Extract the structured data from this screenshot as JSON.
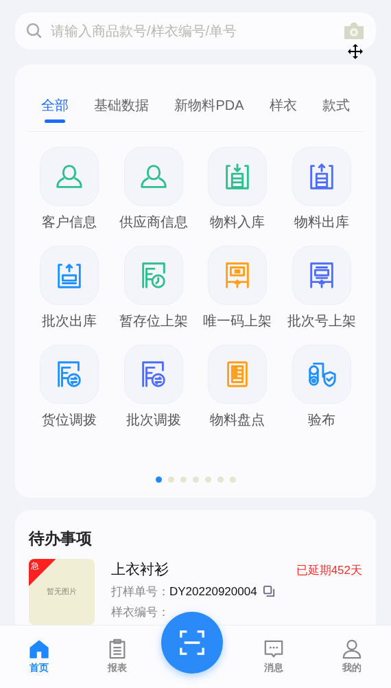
{
  "search": {
    "placeholder": "请输入商品款号/样衣编号/单号"
  },
  "tabs": [
    {
      "label": "全部",
      "selected": true
    },
    {
      "label": "基础数据",
      "selected": false
    },
    {
      "label": "新物料PDA",
      "selected": false
    },
    {
      "label": "样衣",
      "selected": false
    },
    {
      "label": "款式",
      "selected": false
    }
  ],
  "apps": [
    {
      "label": "客户信息",
      "kind": "person",
      "color": "#2fbf8f"
    },
    {
      "label": "供应商信息",
      "kind": "person",
      "color": "#2fbf8f"
    },
    {
      "label": "物料入库",
      "kind": "stock-in",
      "color": "#2fbf8f"
    },
    {
      "label": "物料出库",
      "kind": "stock-out",
      "color": "#4f6ef7"
    },
    {
      "label": "批次出库",
      "kind": "batch-out",
      "color": "#1e90ff"
    },
    {
      "label": "暂存位上架",
      "kind": "clock-shelf",
      "color": "#2fbf8f"
    },
    {
      "label": "唯一码上架",
      "kind": "code-shelf",
      "color": "#ff9f1a"
    },
    {
      "label": "批次号上架",
      "kind": "batch-shelf",
      "color": "#4f6ef7"
    },
    {
      "label": "货位调拨",
      "kind": "transfer",
      "color": "#1e90ff"
    },
    {
      "label": "批次调拨",
      "kind": "transfer",
      "color": "#4f6ef7"
    },
    {
      "label": "物料盘点",
      "kind": "check",
      "color": "#ff9f1a"
    },
    {
      "label": "验布",
      "kind": "fabric",
      "color": "#1e90ff"
    }
  ],
  "pages": [
    {
      "selected": true
    },
    {
      "selected": false
    },
    {
      "selected": false
    },
    {
      "selected": false
    },
    {
      "selected": false
    },
    {
      "selected": false
    },
    {
      "selected": false
    }
  ],
  "todo": {
    "title": "待办事项",
    "items": [
      {
        "badge": "急",
        "image_text": "暂无图片",
        "name": "上衣衬衫",
        "overdue": "已延期452天",
        "fields": [
          {
            "label": "打样单号：",
            "value": "DY20220920004"
          },
          {
            "label": "样衣编号："
          }
        ]
      }
    ]
  },
  "nav": [
    {
      "label": "首页",
      "kind": "home",
      "selected": true
    },
    {
      "label": "报表",
      "kind": "report",
      "selected": false
    },
    {
      "kind": "scan"
    },
    {
      "label": "消息",
      "kind": "message",
      "selected": false
    },
    {
      "label": "我的",
      "kind": "user",
      "selected": false
    }
  ]
}
